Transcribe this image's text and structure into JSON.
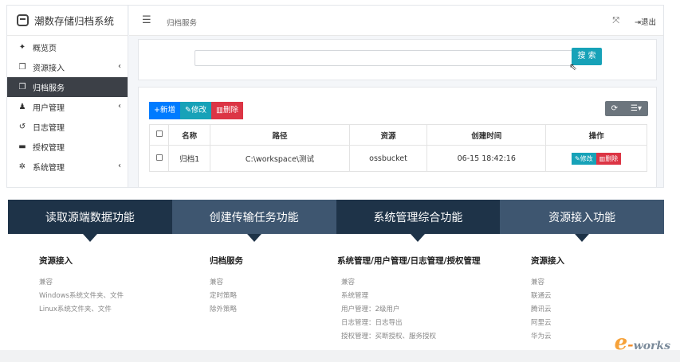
{
  "app": {
    "brand": "潮数存储归档系统",
    "sidebar": [
      {
        "icon": "home-icon",
        "glyph": "✦",
        "label": "概览页",
        "arrow": ""
      },
      {
        "icon": "copy-icon",
        "glyph": "❐",
        "label": "资源接入",
        "arrow": "‹"
      },
      {
        "icon": "copy-icon",
        "glyph": "❐",
        "label": "归档服务",
        "arrow": ""
      },
      {
        "icon": "users-icon",
        "glyph": "♟",
        "label": "用户管理",
        "arrow": "‹"
      },
      {
        "icon": "history-icon",
        "glyph": "↺",
        "label": "日志管理",
        "arrow": ""
      },
      {
        "icon": "briefcase-icon",
        "glyph": "▬",
        "label": "授权管理",
        "arrow": ""
      },
      {
        "icon": "gear-icon",
        "glyph": "✲",
        "label": "系统管理",
        "arrow": "‹"
      }
    ],
    "active_index": 2,
    "breadcrumb": "归档服务",
    "logout": "退出",
    "search_button": "搜 索",
    "toolbar": {
      "add": "新增",
      "edit": "修改",
      "delete": "删除"
    },
    "table": {
      "headers": [
        "名称",
        "路径",
        "资源",
        "创建时间",
        "操作"
      ],
      "rows": [
        {
          "name": "归档1",
          "path": "C:\\workspace\\测试",
          "resource": "ossbucket",
          "created": "06-15 18:42:16"
        }
      ],
      "op_edit": "修改",
      "op_delete": "删除"
    }
  },
  "banner": [
    "读取源端数据功能",
    "创建传输任务功能",
    "系统管理综合功能",
    "资源接入功能"
  ],
  "columns": [
    {
      "title": "资源接入",
      "items": [
        "兼容",
        "Windows系统文件夹、文件",
        "Linux系统文件夹、文件"
      ]
    },
    {
      "title": "归档服务",
      "items": [
        "兼容",
        "定时策略",
        "除外策略"
      ]
    },
    {
      "title": "系统管理/用户管理/日志管理/授权管理",
      "items": [
        "兼容",
        "系统管理",
        "用户管理：2级用户",
        "日志管理：日志导出",
        "授权管理：买断授权、服务授权"
      ]
    },
    {
      "title": "资源接入",
      "items": [
        "兼容",
        "联通云",
        "腾讯云",
        "阿里云",
        "华为云"
      ]
    }
  ],
  "watermark": "e-works"
}
